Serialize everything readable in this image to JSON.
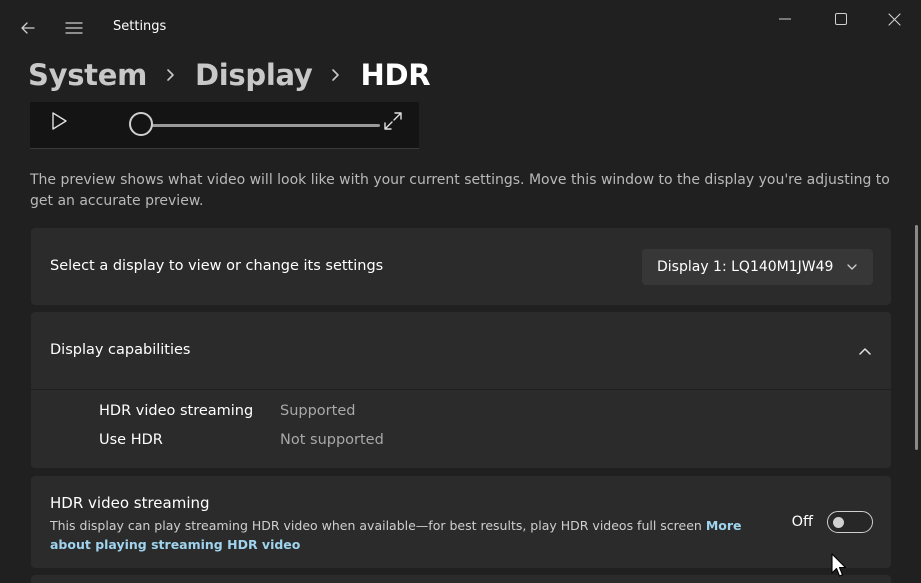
{
  "window": {
    "app_title": "Settings"
  },
  "breadcrumb": {
    "items": [
      "System",
      "Display",
      "HDR"
    ]
  },
  "preview": {
    "note": "The preview shows what video will look like with your current settings. Move this window to the display you're adjusting to get an accurate preview.",
    "seek_progress": 0
  },
  "display_select": {
    "label": "Select a display to view or change its settings",
    "selected": "Display 1: LQ140M1JW49"
  },
  "capabilities": {
    "title": "Display capabilities",
    "expanded": true,
    "rows": [
      {
        "name": "HDR video streaming",
        "value": "Supported"
      },
      {
        "name": "Use HDR",
        "value": "Not supported"
      }
    ]
  },
  "hdr_streaming": {
    "title": "HDR video streaming",
    "description": "This display can play streaming HDR video when available—for best results, play HDR videos full screen",
    "link": "More about playing streaming HDR video",
    "state_label": "Off",
    "enabled": false
  },
  "icons": {
    "back": "back-arrow-icon",
    "menu": "hamburger-menu-icon",
    "minimize": "minimize-icon",
    "maximize": "maximize-icon",
    "close": "close-icon",
    "play": "play-icon",
    "expand": "expand-icon",
    "dropdown": "chevron-down-icon",
    "collapse": "chevron-up-icon"
  },
  "colors": {
    "background": "#202020",
    "card": "#2b2b2b",
    "link": "#9fd3ee"
  }
}
